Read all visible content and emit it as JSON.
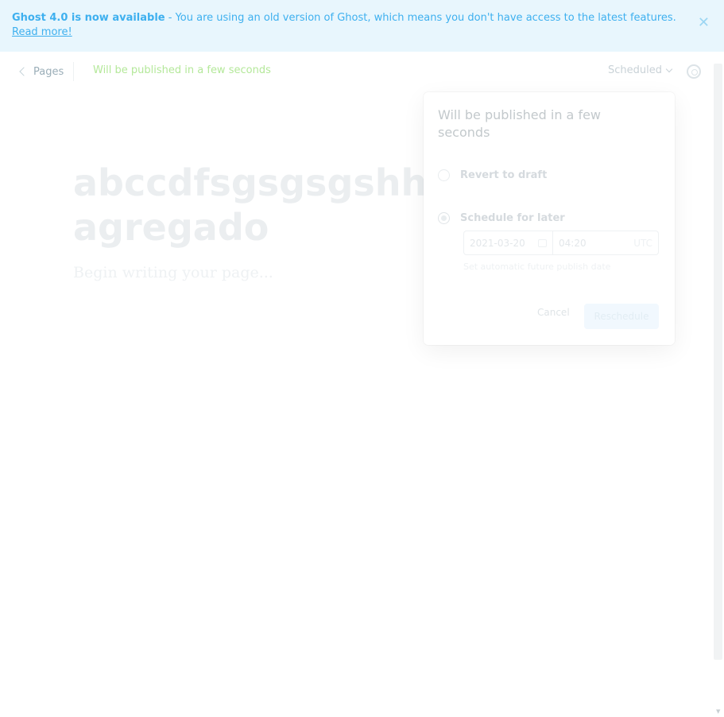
{
  "banner": {
    "bold": "Ghost 4.0 is now available",
    "message": " - You are using an old version of Ghost, which means you don't have access to the latest features.",
    "link": "Read more!",
    "close_icon": "close-icon"
  },
  "topbar": {
    "back_label": "Pages",
    "status": "Will be published in a few seconds",
    "publish_menu": "Scheduled",
    "settings_icon": "gear-icon"
  },
  "editor": {
    "title": "abccdfsgsgsgshhh...texto agregado",
    "body_placeholder": "Begin writing your page..."
  },
  "popover": {
    "title": "Will be published in a few seconds",
    "option_draft": "Revert to draft",
    "option_schedule": "Schedule for later",
    "date_value": "2021-03-20",
    "time_value": "04:20",
    "timezone": "UTC",
    "hint": "Set automatic future publish date",
    "cancel_label": "Cancel",
    "reschedule_label": "Reschedule"
  },
  "colors": {
    "accent": "#3eb0ef",
    "banner_bg": "#e8f6fd",
    "status_green": "#b4e89a"
  }
}
